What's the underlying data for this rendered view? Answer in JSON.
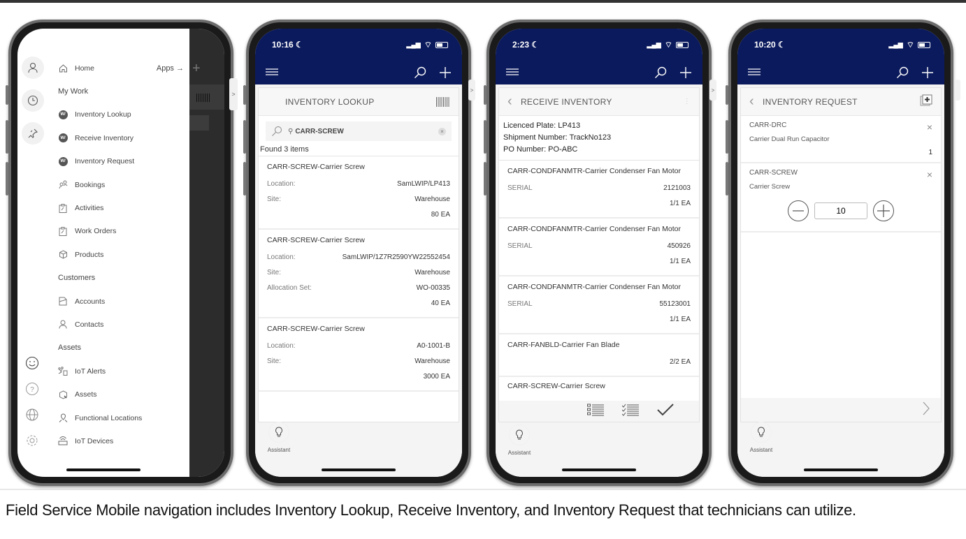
{
  "caption": "Field Service Mobile navigation includes Inventory Lookup, Receive Inventory, and Inventory Request that technicians can utilize.",
  "colors": {
    "app_bar": "#0b1a5c",
    "panel_bg": "#f7f7f7",
    "text": "#333333"
  },
  "nav_phone": {
    "home_label": "Home",
    "apps_label": "Apps →",
    "sections": [
      {
        "title": "My Work",
        "items": [
          {
            "label": "Inventory Lookup",
            "icon": "wrench-badge-icon"
          },
          {
            "label": "Receive Inventory",
            "icon": "wrench-badge-icon"
          },
          {
            "label": "Inventory Request",
            "icon": "wrench-badge-icon"
          },
          {
            "label": "Bookings",
            "icon": "people-icon"
          },
          {
            "label": "Activities",
            "icon": "clipboard-icon"
          },
          {
            "label": "Work Orders",
            "icon": "clipboard-icon"
          },
          {
            "label": "Products",
            "icon": "box-icon"
          }
        ]
      },
      {
        "title": "Customers",
        "items": [
          {
            "label": "Accounts",
            "icon": "account-icon"
          },
          {
            "label": "Contacts",
            "icon": "person-icon"
          }
        ]
      },
      {
        "title": "Assets",
        "items": [
          {
            "label": "IoT Alerts",
            "icon": "iot-alert-icon"
          },
          {
            "label": "Assets",
            "icon": "asset-icon"
          },
          {
            "label": "Functional Locations",
            "icon": "location-pin-icon"
          },
          {
            "label": "IoT Devices",
            "icon": "router-icon"
          }
        ]
      }
    ],
    "rail_top": [
      "person-icon",
      "clock-icon",
      "pin-icon"
    ],
    "rail_bottom": [
      "smiley-icon",
      "help-icon",
      "globe-icon",
      "gear-icon"
    ]
  },
  "lookup_phone": {
    "time": "10:16",
    "title": "INVENTORY LOOKUP",
    "search_value": "CARR-SCREW",
    "found_text": "Found 3 items",
    "items": [
      {
        "name": "CARR-SCREW-Carrier Screw",
        "fields": [
          {
            "label": "Location:",
            "value": "SamLWIP/LP413"
          },
          {
            "label": "Site:",
            "value": "Warehouse"
          }
        ],
        "qty": "80 EA"
      },
      {
        "name": "CARR-SCREW-Carrier Screw",
        "fields": [
          {
            "label": "Location:",
            "value": "SamLWIP/1Z7R2590YW22552454"
          },
          {
            "label": "Site:",
            "value": "Warehouse"
          },
          {
            "label": "Allocation Set:",
            "value": "WO-00335"
          }
        ],
        "qty": "40 EA"
      },
      {
        "name": "CARR-SCREW-Carrier Screw",
        "fields": [
          {
            "label": "Location:",
            "value": "A0-1001-B"
          },
          {
            "label": "Site:",
            "value": "Warehouse"
          }
        ],
        "qty": "3000 EA"
      }
    ],
    "assistant_label": "Assistant"
  },
  "receive_phone": {
    "time": "2:23",
    "title": "RECEIVE INVENTORY",
    "licence_plate": "Licenced Plate: LP413",
    "shipment_number": "Shipment Number: TrackNo123",
    "po_number": "PO Number: PO-ABC",
    "items": [
      {
        "name": "CARR-CONDFANMTR-Carrier Condenser Fan Motor",
        "serial_label": "SERIAL",
        "serial": "2121003",
        "qty": "1/1 EA"
      },
      {
        "name": "CARR-CONDFANMTR-Carrier Condenser Fan Motor",
        "serial_label": "SERIAL",
        "serial": "450926",
        "qty": "1/1 EA"
      },
      {
        "name": "CARR-CONDFANMTR-Carrier Condenser Fan Motor",
        "serial_label": "SERIAL",
        "serial": "55123001",
        "qty": "1/1 EA"
      },
      {
        "name": "CARR-FANBLD-Carrier Fan Blade",
        "serial_label": "",
        "serial": "",
        "qty": "2/2 EA"
      }
    ],
    "partial_item": "CARR-SCREW-Carrier Screw",
    "assistant_label": "Assistant"
  },
  "request_phone": {
    "time": "10:20",
    "title": "INVENTORY REQUEST",
    "items": [
      {
        "code": "CARR-DRC",
        "desc": "Carrier Dual Run Capacitor",
        "qty": "1"
      },
      {
        "code": "CARR-SCREW",
        "desc": "Carrier Screw",
        "qty": "10"
      }
    ],
    "assistant_label": "Assistant"
  }
}
